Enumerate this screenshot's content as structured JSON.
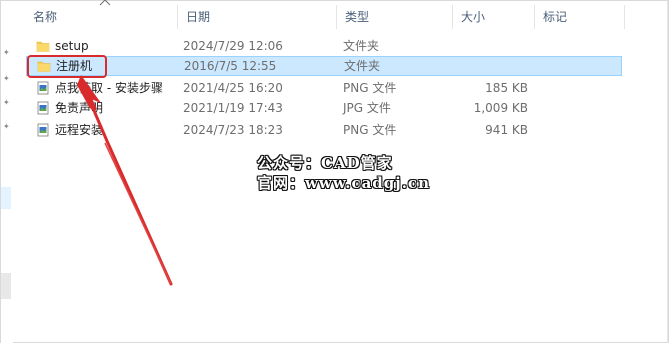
{
  "columns": {
    "name": "名称",
    "date": "日期",
    "type": "类型",
    "size": "大小",
    "tags": "标记"
  },
  "files": [
    {
      "name": "setup",
      "date": "2024/7/29 12:06",
      "type": "文件夹",
      "size": "",
      "icon": "folder-icon",
      "selected": false
    },
    {
      "name": "注册机",
      "date": "2016/7/5 12:55",
      "type": "文件夹",
      "size": "",
      "icon": "folder-icon",
      "selected": true
    },
    {
      "name": "点我获取 - 安装步骤",
      "date": "2021/4/25 16:20",
      "type": "PNG 文件",
      "size": "185 KB",
      "icon": "image-file-icon",
      "selected": false
    },
    {
      "name": "免责声明",
      "date": "2021/1/19 17:43",
      "type": "JPG 文件",
      "size": "1,009 KB",
      "icon": "image-file-icon",
      "selected": false
    },
    {
      "name": "远程安装",
      "date": "2024/7/23 18:23",
      "type": "PNG 文件",
      "size": "941 KB",
      "icon": "image-file-icon",
      "selected": false
    }
  ],
  "watermark": {
    "line1": "公众号：CAD管家",
    "line2": "官网：www.cadgj.cn"
  },
  "colors": {
    "selection_bg": "#cce8ff",
    "selection_border": "#99d1ff",
    "annotation_red": "#d92b2b",
    "folder_yellow": "#f6cd55"
  }
}
